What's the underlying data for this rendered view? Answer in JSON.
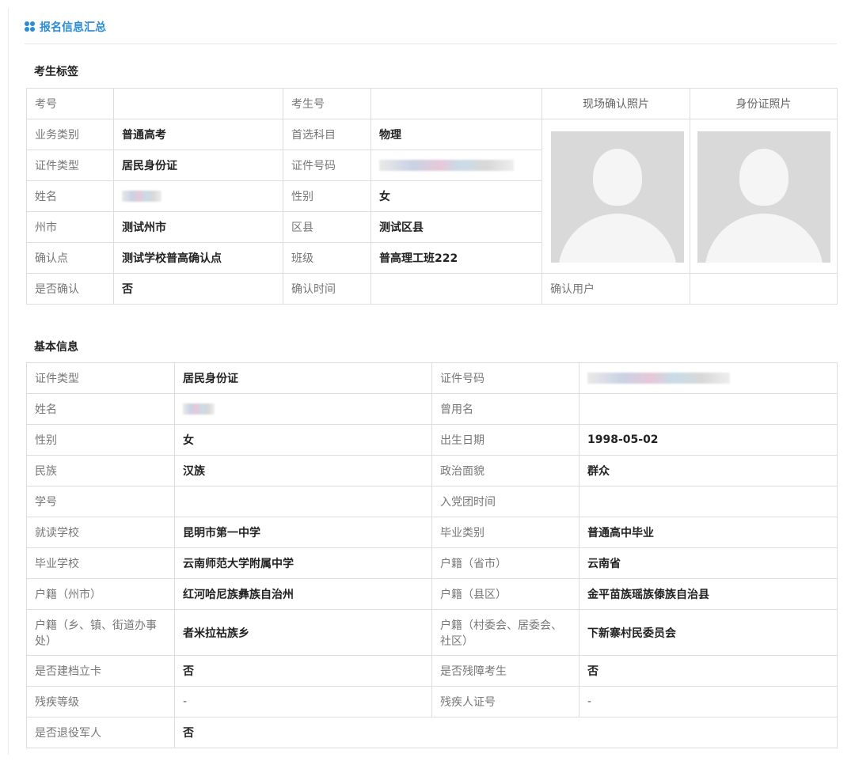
{
  "page": {
    "title": "报名信息汇总"
  },
  "candidate": {
    "section_title": "考生标签",
    "rows": [
      {
        "l1": "考号",
        "v1": "",
        "l2": "考生号",
        "v2": ""
      },
      {
        "l1": "业务类别",
        "v1": "普通高考",
        "l2": "首选科目",
        "v2": "物理"
      },
      {
        "l1": "证件类型",
        "v1": "居民身份证",
        "l2": "证件号码",
        "v2": ""
      },
      {
        "l1": "姓名",
        "v1": "",
        "l2": "性别",
        "v2": "女"
      },
      {
        "l1": "州市",
        "v1": "测试州市",
        "l2": "区县",
        "v2": "测试区县"
      },
      {
        "l1": "确认点",
        "v1": "测试学校普高确认点",
        "l2": "班级",
        "v2": "普高理工班222"
      },
      {
        "l1": "是否确认",
        "v1": "否",
        "l2": "确认时间",
        "v2": ""
      }
    ],
    "photo_site_label": "现场确认照片",
    "photo_id_label": "身份证照片",
    "confirm_user_label": "确认用户",
    "confirm_user_value": ""
  },
  "basic": {
    "section_title": "基本信息",
    "rows": [
      {
        "l1": "证件类型",
        "v1": "居民身份证",
        "l2": "证件号码",
        "v2": ""
      },
      {
        "l1": "姓名",
        "v1": "",
        "l2": "曾用名",
        "v2": ""
      },
      {
        "l1": "性别",
        "v1": "女",
        "l2": "出生日期",
        "v2": "1998-05-02"
      },
      {
        "l1": "民族",
        "v1": "汉族",
        "l2": "政治面貌",
        "v2": "群众"
      },
      {
        "l1": "学号",
        "v1": "",
        "l2": "入党团时间",
        "v2": ""
      },
      {
        "l1": "就读学校",
        "v1": "昆明市第一中学",
        "l2": "毕业类别",
        "v2": "普通高中毕业"
      },
      {
        "l1": "毕业学校",
        "v1": "云南师范大学附属中学",
        "l2": "户籍（省市）",
        "v2": "云南省"
      },
      {
        "l1": "户籍（州市）",
        "v1": "红河哈尼族彝族自治州",
        "l2": "户籍（县区）",
        "v2": "金平苗族瑶族傣族自治县"
      },
      {
        "l1": "户籍（乡、镇、街道办事处）",
        "v1": "者米拉祜族乡",
        "l2": "户籍（村委会、居委会、社区）",
        "v2": "下新寨村民委员会"
      },
      {
        "l1": "是否建档立卡",
        "v1": "否",
        "l2": "是否残障考生",
        "v2": "否"
      },
      {
        "l1": "残疾等级",
        "v1": "-",
        "l2": "残疾人证号",
        "v2": "-"
      },
      {
        "l1": "是否退役军人",
        "v1": "否"
      }
    ]
  }
}
